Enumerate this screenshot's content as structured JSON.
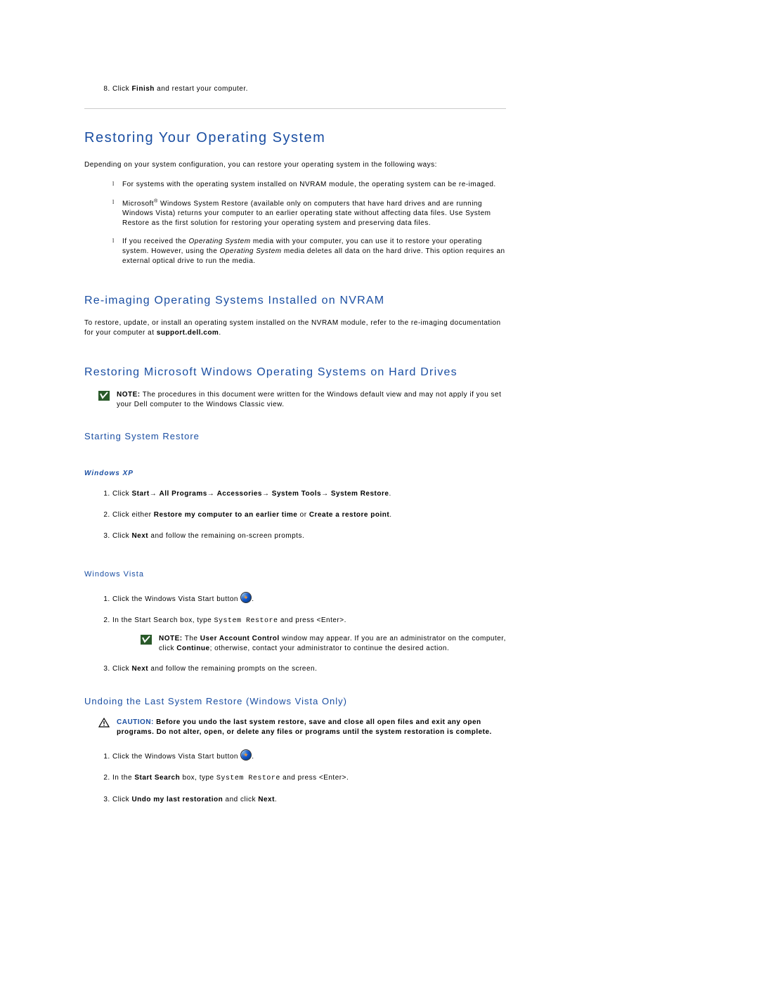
{
  "prior_step": {
    "number": 8,
    "prefix": "Click ",
    "bold": "Finish",
    "suffix": " and restart your computer."
  },
  "main_heading": "Restoring Your Operating System",
  "intro": "Depending on your system configuration, you can restore your operating system in the following ways:",
  "bullets": {
    "b1": "For systems with the operating system installed on NVRAM module, the operating system can be re-imaged.",
    "b2_a": "Microsoft",
    "b2_reg": "®",
    "b2_b": " Windows System Restore (available only on computers that have hard drives and are running Windows Vista) returns your computer to an earlier operating state without affecting data files. Use System Restore as the first solution for restoring your operating system and preserving data files.",
    "b3_a": "If you received the ",
    "b3_i1": "Operating System",
    "b3_b": " media with your computer, you can use it to restore your operating system. However, using the ",
    "b3_i2": "Operating System",
    "b3_c": " media deletes all data on the hard drive. This option requires an external optical drive to run the media."
  },
  "nvram": {
    "heading": "Re-imaging Operating Systems Installed on NVRAM",
    "body_a": "To restore, update, or install an operating system installed on the NVRAM module, refer to the re-imaging documentation for your computer at ",
    "body_bold": "support.dell.com",
    "body_b": "."
  },
  "harddrive": {
    "heading": "Restoring Microsoft Windows Operating Systems on Hard Drives",
    "note_label": "NOTE:",
    "note_text": " The procedures in this document were written for the Windows default view and may not apply if you set your Dell computer to the Windows Classic view."
  },
  "starting_restore": {
    "heading": "Starting System Restore",
    "xp_heading": "Windows XP",
    "xp_steps": {
      "s1_a": "Click ",
      "s1_b1": "Start",
      "s1_arr1": "→ ",
      "s1_b2": "All Programs",
      "s1_arr2": "→ ",
      "s1_b3": "Accessories",
      "s1_arr3": "→ ",
      "s1_b4": "System Tools",
      "s1_arr4": "→ ",
      "s1_b5": "System Restore",
      "s1_c": ".",
      "s2_a": "Click either ",
      "s2_b1": "Restore my computer to an earlier time",
      "s2_b": " or ",
      "s2_b2": "Create a restore point",
      "s2_c": ".",
      "s3_a": "Click ",
      "s3_b": "Next",
      "s3_c": " and follow the remaining on-screen prompts."
    },
    "vista_heading": "Windows Vista",
    "vista_steps": {
      "s1_a": "Click the Windows Vista Start button ",
      "s1_b": ".",
      "s2_a": "In the Start Search box, type ",
      "s2_code": "System Restore",
      "s2_b": " and press <Enter>.",
      "note_label": "NOTE:",
      "note_a": " The ",
      "note_b1": "User Account Control",
      "note_b": " window may appear. If you are an administrator on the computer, click ",
      "note_b2": "Continue",
      "note_c": "; otherwise, contact your administrator to continue the desired action.",
      "s3_a": "Click ",
      "s3_b": "Next",
      "s3_c": " and follow the remaining prompts on the screen."
    }
  },
  "undo": {
    "heading": "Undoing the Last System Restore (Windows Vista Only)",
    "caution_label": "CAUTION:",
    "caution_text": " Before you undo the last system restore, save and close all open files and exit any open programs. Do not alter, open, or delete any files or programs until the system restoration is complete.",
    "steps": {
      "s1_a": "Click the Windows Vista Start button ",
      "s1_b": ".",
      "s2_a": "In the ",
      "s2_b1": "Start Search",
      "s2_b": " box, type ",
      "s2_code": "System Restore",
      "s2_c": " and press <Enter>.",
      "s3_a": "Click ",
      "s3_b1": "Undo my last restoration",
      "s3_b": " and click ",
      "s3_b2": "Next",
      "s3_c": "."
    }
  }
}
